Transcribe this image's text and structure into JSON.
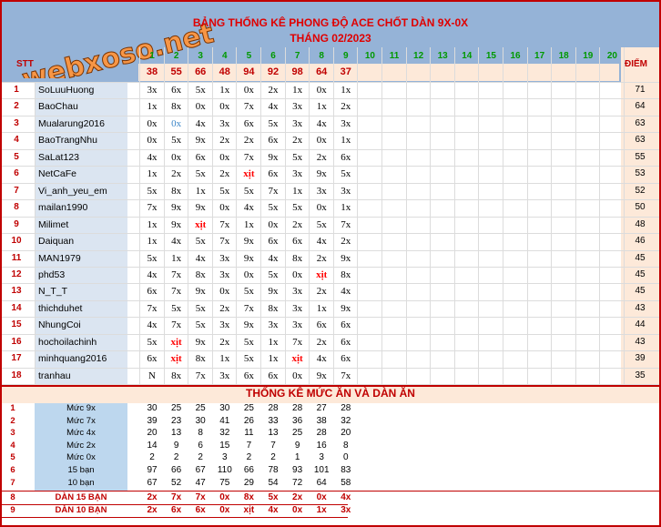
{
  "title_line1": "BẢNG THỐNG KÊ PHONG ĐỘ ACE CHỐT DÀN 9X-0X",
  "title_line2": "THÁNG 02/2023",
  "stt_label": "STT",
  "diem_label": "ĐIỂM",
  "logo_text": "webxoso.net",
  "day_numbers": [
    "1",
    "2",
    "3",
    "4",
    "5",
    "6",
    "7",
    "8",
    "9",
    "10",
    "11",
    "12",
    "13",
    "14",
    "15",
    "16",
    "17",
    "18",
    "19",
    "20"
  ],
  "day_sums": [
    "38",
    "55",
    "66",
    "48",
    "94",
    "92",
    "98",
    "64",
    "37"
  ],
  "players": [
    {
      "no": "1",
      "name": "SoLuuHuong",
      "picks": [
        "3x",
        "6x",
        "5x",
        "1x",
        "0x",
        "2x",
        "1x",
        "0x",
        "1x"
      ],
      "score": "71"
    },
    {
      "no": "2",
      "name": "BaoChau",
      "picks": [
        "1x",
        "8x",
        "0x",
        "0x",
        "7x",
        "4x",
        "3x",
        "1x",
        "2x"
      ],
      "score": "64"
    },
    {
      "no": "3",
      "name": "Mualarung2016",
      "picks": [
        "0x",
        "0x",
        "4x",
        "3x",
        "6x",
        "5x",
        "3x",
        "4x",
        "3x"
      ],
      "score": "63"
    },
    {
      "no": "4",
      "name": "BaoTrangNhu",
      "picks": [
        "0x",
        "5x",
        "9x",
        "2x",
        "2x",
        "6x",
        "2x",
        "0x",
        "1x"
      ],
      "score": "63"
    },
    {
      "no": "5",
      "name": "SaLat123",
      "picks": [
        "4x",
        "0x",
        "6x",
        "0x",
        "7x",
        "9x",
        "5x",
        "2x",
        "6x"
      ],
      "score": "55"
    },
    {
      "no": "6",
      "name": "NetCaFe",
      "picks": [
        "1x",
        "2x",
        "5x",
        "2x",
        "xịt",
        "6x",
        "3x",
        "9x",
        "5x"
      ],
      "score": "53"
    },
    {
      "no": "7",
      "name": "Vi_anh_yeu_em",
      "picks": [
        "5x",
        "8x",
        "1x",
        "5x",
        "5x",
        "7x",
        "1x",
        "3x",
        "3x"
      ],
      "score": "52"
    },
    {
      "no": "8",
      "name": "mailan1990",
      "picks": [
        "7x",
        "9x",
        "9x",
        "0x",
        "4x",
        "5x",
        "5x",
        "0x",
        "1x"
      ],
      "score": "50"
    },
    {
      "no": "9",
      "name": "Milimet",
      "picks": [
        "1x",
        "9x",
        "xịt",
        "7x",
        "1x",
        "0x",
        "2x",
        "5x",
        "7x"
      ],
      "score": "48"
    },
    {
      "no": "10",
      "name": "Daiquan",
      "picks": [
        "1x",
        "4x",
        "5x",
        "7x",
        "9x",
        "6x",
        "6x",
        "4x",
        "2x"
      ],
      "score": "46"
    },
    {
      "no": "11",
      "name": "MAN1979",
      "picks": [
        "5x",
        "1x",
        "4x",
        "3x",
        "9x",
        "4x",
        "8x",
        "2x",
        "9x"
      ],
      "score": "45"
    },
    {
      "no": "12",
      "name": "phd53",
      "picks": [
        "4x",
        "7x",
        "8x",
        "3x",
        "0x",
        "5x",
        "0x",
        "xịt",
        "8x"
      ],
      "score": "45"
    },
    {
      "no": "13",
      "name": "N_T_T",
      "picks": [
        "6x",
        "7x",
        "9x",
        "0x",
        "5x",
        "9x",
        "3x",
        "2x",
        "4x"
      ],
      "score": "45"
    },
    {
      "no": "14",
      "name": "thichduhet",
      "picks": [
        "7x",
        "5x",
        "5x",
        "2x",
        "7x",
        "8x",
        "3x",
        "1x",
        "9x"
      ],
      "score": "43"
    },
    {
      "no": "15",
      "name": "NhungCoi",
      "picks": [
        "4x",
        "7x",
        "5x",
        "3x",
        "9x",
        "3x",
        "3x",
        "6x",
        "6x"
      ],
      "score": "44"
    },
    {
      "no": "16",
      "name": "hochoilachinh",
      "picks": [
        "5x",
        "xịt",
        "9x",
        "2x",
        "5x",
        "1x",
        "7x",
        "2x",
        "6x"
      ],
      "score": "43"
    },
    {
      "no": "17",
      "name": "minhquang2016",
      "picks": [
        "6x",
        "xịt",
        "8x",
        "1x",
        "5x",
        "1x",
        "xịt",
        "4x",
        "6x"
      ],
      "score": "39"
    },
    {
      "no": "18",
      "name": "tranhau",
      "picks": [
        "N",
        "8x",
        "7x",
        "3x",
        "6x",
        "6x",
        "0x",
        "9x",
        "7x"
      ],
      "score": "35"
    }
  ],
  "section2_title": "THỐNG KÊ MỨC ĂN VÀ DÀN ĂN",
  "stats": [
    {
      "no": "1",
      "label": "Mức 9x",
      "values": [
        "30",
        "25",
        "25",
        "30",
        "25",
        "28",
        "28",
        "27",
        "28"
      ]
    },
    {
      "no": "2",
      "label": "Mức 7x",
      "values": [
        "39",
        "23",
        "30",
        "41",
        "26",
        "33",
        "36",
        "38",
        "32"
      ]
    },
    {
      "no": "3",
      "label": "Mức 4x",
      "values": [
        "20",
        "13",
        "8",
        "32",
        "11",
        "13",
        "25",
        "28",
        "20"
      ]
    },
    {
      "no": "4",
      "label": "Mức 2x",
      "values": [
        "14",
        "9",
        "6",
        "15",
        "7",
        "7",
        "9",
        "16",
        "8"
      ]
    },
    {
      "no": "5",
      "label": "Mức 0x",
      "values": [
        "2",
        "2",
        "2",
        "3",
        "2",
        "2",
        "1",
        "3",
        "0"
      ]
    },
    {
      "no": "6",
      "label": "15 bạn",
      "values": [
        "97",
        "66",
        "67",
        "110",
        "66",
        "78",
        "93",
        "101",
        "83"
      ]
    },
    {
      "no": "7",
      "label": "10 bạn",
      "values": [
        "67",
        "52",
        "47",
        "75",
        "29",
        "54",
        "72",
        "64",
        "58"
      ]
    }
  ],
  "dan": [
    {
      "no": "8",
      "label": "DÀN 15 BẠN",
      "values": [
        "2x",
        "7x",
        "7x",
        "0x",
        "8x",
        "5x",
        "2x",
        "0x",
        "4x"
      ]
    },
    {
      "no": "9",
      "label": "DÀN 10 BẠN",
      "values": [
        "2x",
        "6x",
        "6x",
        "0x",
        "xịt",
        "4x",
        "0x",
        "1x",
        "3x"
      ]
    }
  ],
  "colors": {
    "accent_red": "#c00000",
    "header_blue": "#95b3d7",
    "name_blue": "#dbe5f1",
    "peach": "#fde9d9",
    "green": "#009900",
    "logo_orange": "#f79646"
  }
}
